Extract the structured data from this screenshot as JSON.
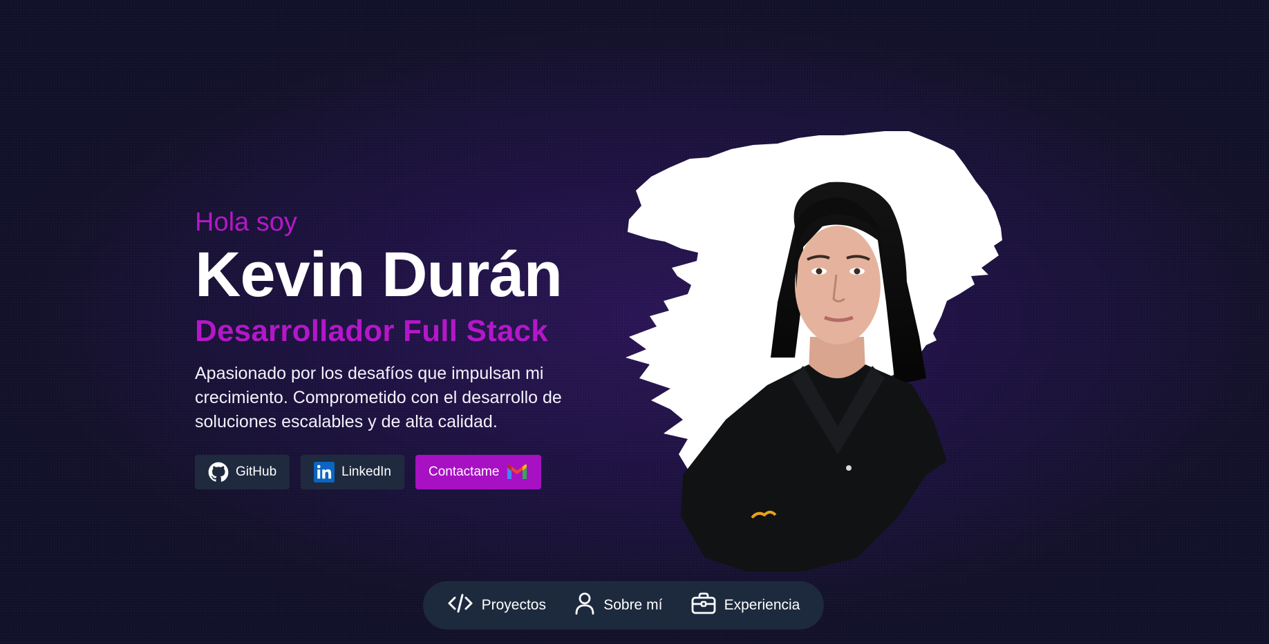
{
  "hero": {
    "greeting": "Hola soy",
    "name": "Kevin Durán",
    "role": "Desarrollador Full Stack",
    "description": "Apasionado por los desafíos que impulsan mi crecimiento. Comprometido con el desarrollo de soluciones escalables y de alta calidad.",
    "buttons": [
      {
        "label": "GitHub",
        "icon": "github-icon"
      },
      {
        "label": "LinkedIn",
        "icon": "linkedin-icon"
      },
      {
        "label": "Contactame",
        "icon": "gmail-icon"
      }
    ]
  },
  "nav": {
    "items": [
      {
        "label": "Proyectos",
        "icon": "code-icon"
      },
      {
        "label": "Sobre mí",
        "icon": "user-icon"
      },
      {
        "label": "Experiencia",
        "icon": "briefcase-icon"
      }
    ]
  },
  "colors": {
    "accent": "#b417c9",
    "button_dark": "#1f2a3e",
    "background": "#1d1240"
  }
}
